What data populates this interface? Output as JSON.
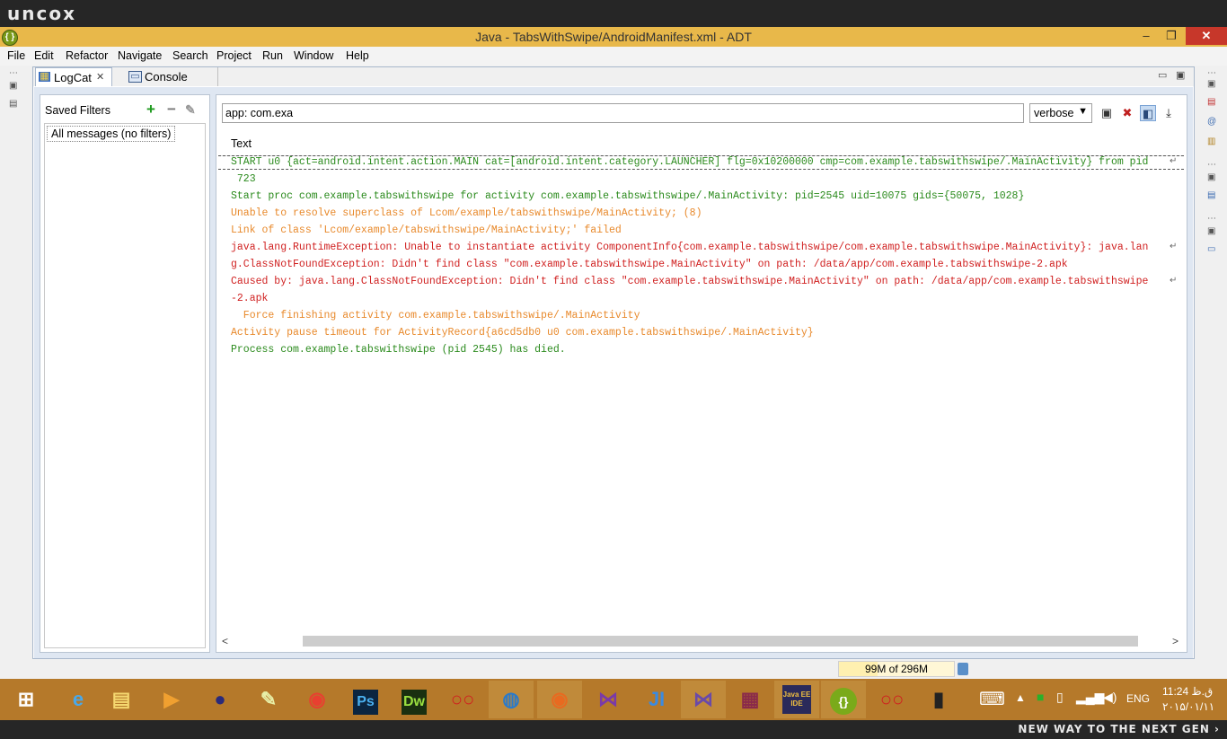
{
  "brand": {
    "logo": "uncox",
    "slogan": "NEW WAY TO THE NEXT GEN ›"
  },
  "window": {
    "title": "Java - TabsWithSwipe/AndroidManifest.xml - ADT",
    "minimize": "–",
    "maximize": "❐",
    "close": "✕"
  },
  "menu": [
    "File",
    "Edit",
    "Refactor",
    "Navigate",
    "Search",
    "Project",
    "Run",
    "Window",
    "Help"
  ],
  "tabs": {
    "logcat": "LogCat",
    "console": "Console",
    "close_glyph": "✕"
  },
  "filters": {
    "header": "Saved Filters",
    "items": [
      "All messages (no filters)"
    ]
  },
  "logcat": {
    "search_value": "app: com.exa",
    "level": "verbose",
    "column_header": "Text",
    "colors": {
      "info": "#2a8a1c",
      "warn": "#e8892b",
      "error": "#d02020"
    },
    "rows": [
      {
        "text": "START u0 {act=android.intent.action.MAIN cat=[android.intent.category.LAUNCHER] flg=0x10200000 cmp=com.example.tabswithswipe/.MainActivity} from pid",
        "level": "info",
        "wrap": true
      },
      {
        "text": " 723",
        "level": "info"
      },
      {
        "text": "Start proc com.example.tabswithswipe for activity com.example.tabswithswipe/.MainActivity: pid=2545 uid=10075 gids={50075, 1028}",
        "level": "info"
      },
      {
        "text": "Unable to resolve superclass of Lcom/example/tabswithswipe/MainActivity; (8)",
        "level": "warn"
      },
      {
        "text": "Link of class 'Lcom/example/tabswithswipe/MainActivity;' failed",
        "level": "warn"
      },
      {
        "text": "java.lang.RuntimeException: Unable to instantiate activity ComponentInfo{com.example.tabswithswipe/com.example.tabswithswipe.MainActivity}: java.lan",
        "level": "error",
        "wrap": true
      },
      {
        "text": "g.ClassNotFoundException: Didn't find class \"com.example.tabswithswipe.MainActivity\" on path: /data/app/com.example.tabswithswipe-2.apk",
        "level": "error"
      },
      {
        "text": "Caused by: java.lang.ClassNotFoundException: Didn't find class \"com.example.tabswithswipe.MainActivity\" on path: /data/app/com.example.tabswithswipe",
        "level": "error",
        "wrap": true
      },
      {
        "text": "-2.apk",
        "level": "error"
      },
      {
        "text": "  Force finishing activity com.example.tabswithswipe/.MainActivity",
        "level": "warn"
      },
      {
        "text": "Activity pause timeout for ActivityRecord{a6cd5db0 u0 com.example.tabswithswipe/.MainActivity}",
        "level": "warn"
      },
      {
        "text": "Process com.example.tabswithswipe (pid 2545) has died.",
        "level": "info"
      }
    ]
  },
  "status": {
    "heap": "99M of 296M",
    "heap_used_fraction": 0.334
  },
  "taskbar": {
    "apps": [
      "windows-start",
      "internet-explorer",
      "file-explorer",
      "media-player",
      "eclipse",
      "notepad",
      "chrome",
      "photoshop",
      "dreamweaver",
      "app-red",
      "globe-app",
      "firefox",
      "visual-studio",
      "jetbrains",
      "visual-studio-2",
      "winrar",
      "java-ee-ide",
      "adt",
      "app-red-2",
      "phone-emulator"
    ],
    "labels": {
      "photoshop": "Ps",
      "dreamweaver": "Dw",
      "jetbrains": "JI",
      "java-ee-ide": "Java EE IDE",
      "adt": "{}"
    },
    "tray": {
      "lang": "ENG",
      "time": "11:24 ق.ظ",
      "date": "۲۰۱۵/۰۱/۱۱"
    }
  }
}
